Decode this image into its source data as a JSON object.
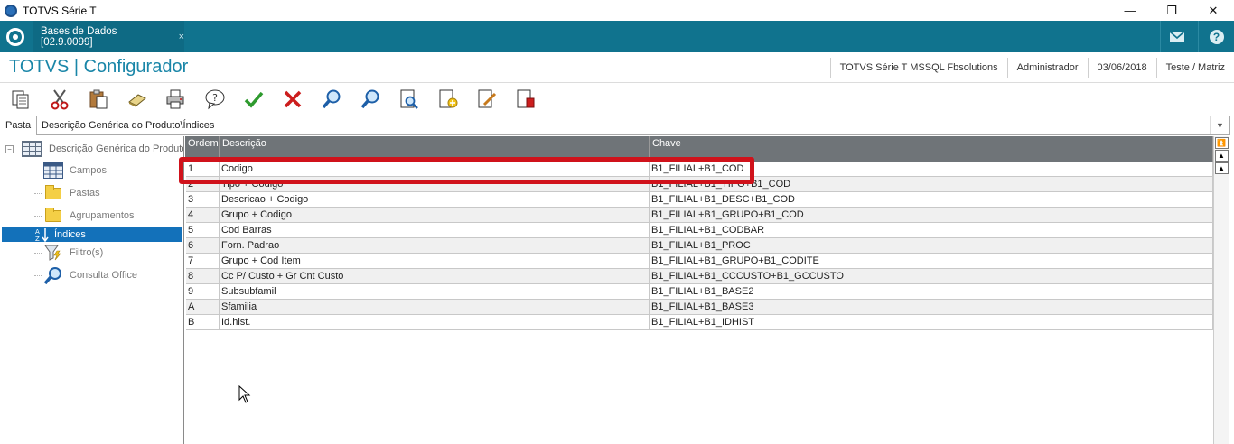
{
  "window": {
    "title": "TOTVS Série T",
    "minimize": "—",
    "restore": "❐",
    "close": "✕"
  },
  "tabbar": {
    "tab_label": "Bases de Dados [02.9.0099]",
    "tab_close": "×",
    "help": "?"
  },
  "header": {
    "title": "TOTVS | Configurador",
    "environment": "TOTVS Série T  MSSQL Fbsolutions",
    "user": "Administrador",
    "date": "03/06/2018",
    "branch": "Teste / Matriz"
  },
  "toolbar": {
    "icons": [
      "copy-icon",
      "cut-icon",
      "paste-icon",
      "eraser-icon",
      "print-icon",
      "help-icon",
      "confirm-icon",
      "cancel-icon",
      "search-icon",
      "search-next-icon",
      "preview-icon",
      "new-icon",
      "edit-icon",
      "delete-icon"
    ]
  },
  "pasta": {
    "label": "Pasta",
    "path": "Descrição Genérica do Produto\\Índices"
  },
  "tree": {
    "root": "Descrição Genérica do Produto",
    "items": [
      {
        "label": "Campos",
        "icon": "table-icon"
      },
      {
        "label": "Pastas",
        "icon": "folder-icon"
      },
      {
        "label": "Agrupamentos",
        "icon": "folder-icon"
      },
      {
        "label": "Índices",
        "icon": "sort-az-icon"
      },
      {
        "label": "Filtro(s)",
        "icon": "filter-icon"
      },
      {
        "label": "Consulta Office",
        "icon": "search-icon"
      }
    ]
  },
  "grid": {
    "columns": [
      "Ordem",
      "Descrição",
      "Chave"
    ],
    "rows": [
      [
        "1",
        "Codigo",
        "B1_FILIAL+B1_COD"
      ],
      [
        "2",
        "Tipo + Codigo",
        "B1_FILIAL+B1_TIPO+B1_COD"
      ],
      [
        "3",
        "Descricao + Codigo",
        "B1_FILIAL+B1_DESC+B1_COD"
      ],
      [
        "4",
        "Grupo + Codigo",
        "B1_FILIAL+B1_GRUPO+B1_COD"
      ],
      [
        "5",
        "Cod Barras",
        "B1_FILIAL+B1_CODBAR"
      ],
      [
        "6",
        "Forn. Padrao",
        "B1_FILIAL+B1_PROC"
      ],
      [
        "7",
        "Grupo + Cod Item",
        "B1_FILIAL+B1_GRUPO+B1_CODITE"
      ],
      [
        "8",
        "Cc P/ Custo + Gr Cnt Custo",
        "B1_FILIAL+B1_CCCUSTO+B1_GCCUSTO"
      ],
      [
        "9",
        "Subsubfamil",
        "B1_FILIAL+B1_BASE2"
      ],
      [
        "A",
        "Sfamilia",
        "B1_FILIAL+B1_BASE3"
      ],
      [
        "B",
        "Id.hist.",
        "B1_FILIAL+B1_IDHIST"
      ]
    ],
    "highlight_color": "#d0121b"
  },
  "colors": {
    "accent": "#10738e",
    "title": "#1a86a8",
    "selection": "#1371ba"
  }
}
